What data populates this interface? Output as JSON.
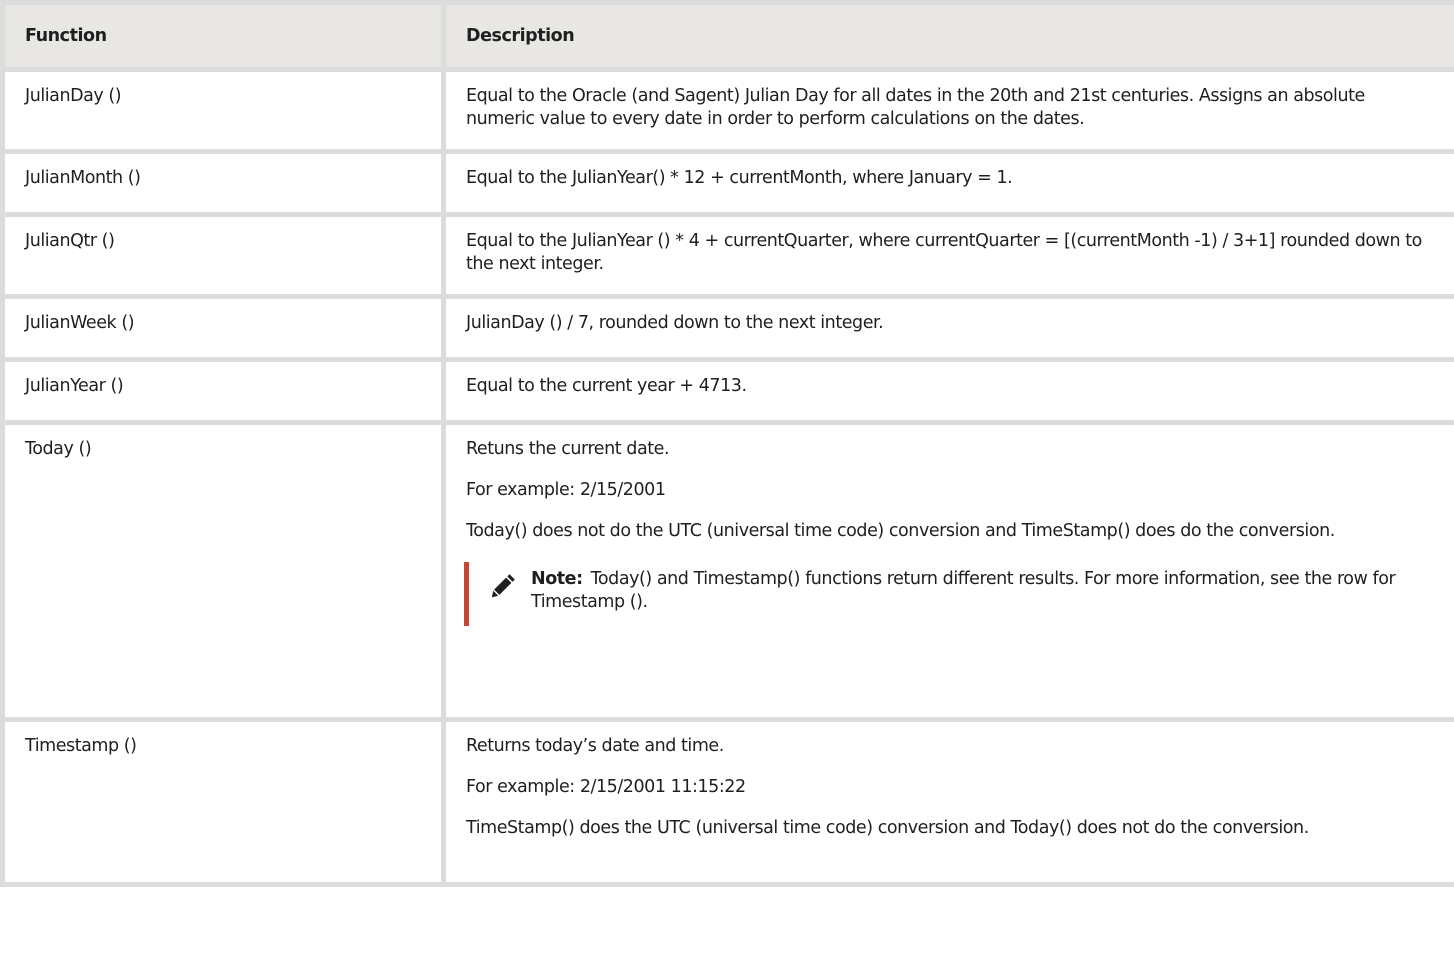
{
  "table": {
    "headers": {
      "function": "Function",
      "description": "Description"
    },
    "rows": [
      {
        "function": "JulianDay ()",
        "description": [
          "Equal to the Oracle (and Sagent) Julian Day for all dates in the 20th and 21st centuries. Assigns an absolute numeric value to every date in order to perform calculations on the dates."
        ]
      },
      {
        "function": "JulianMonth ()",
        "description": [
          "Equal to the JulianYear() * 12 + currentMonth, where January = 1."
        ]
      },
      {
        "function": "JulianQtr ()",
        "description": [
          "Equal to the JulianYear () * 4 + currentQuarter, where currentQuarter = [(currentMonth -1) / 3+1] rounded down to the next integer."
        ]
      },
      {
        "function": "JulianWeek ()",
        "description": [
          "JulianDay () / 7, rounded down to the next integer."
        ]
      },
      {
        "function": "JulianYear ()",
        "description": [
          "Equal to the current year + 4713."
        ]
      },
      {
        "function": "Today ()",
        "description": [
          "Retuns the current date.",
          "For example: 2/15/2001",
          "Today() does not do the UTC (universal time code) conversion and TimeStamp() does do the conversion."
        ],
        "note": {
          "label": "Note:",
          "text": "Today() and Timestamp() functions return different results. For more information, see the row for Timestamp ().",
          "icon": "pencil-icon",
          "accent_color": "#c74634"
        }
      },
      {
        "function": "Timestamp ()",
        "description": [
          "Returns today’s date and time.",
          "For example: 2/15/2001 11:15:22",
          "TimeStamp() does the UTC (universal time code) conversion and Today() does not do the conversion."
        ]
      }
    ]
  },
  "colors": {
    "header_bg": "#e9e7e3",
    "border": "#dcdcdc",
    "note_accent": "#c74634"
  }
}
